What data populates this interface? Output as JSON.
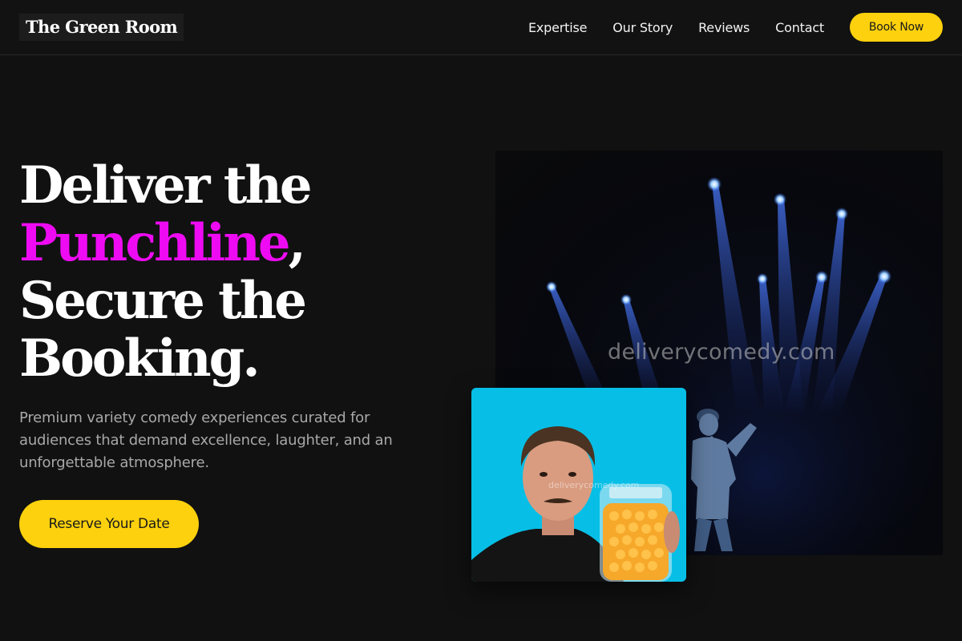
{
  "brand": {
    "name": "The Green Room"
  },
  "nav": {
    "links": [
      "Expertise",
      "Our Story",
      "Reviews",
      "Contact"
    ],
    "cta_label": "Book Now"
  },
  "hero": {
    "title_line1": "Deliver the",
    "title_accent": "Punchline",
    "title_comma": ",",
    "title_line3": "Secure the",
    "title_line4": "Booking.",
    "subtitle": "Premium variety comedy experiences curated for audiences that demand excellence, laughter, and an unforgettable atmosphere.",
    "cta_label": "Reserve Your Date"
  },
  "images": {
    "stage_watermark": "deliverycomedy.com",
    "photo_watermark": "deliverycomedy.com"
  },
  "colors": {
    "accent_yellow": "#fdd10d",
    "accent_magenta": "#ee0bf3",
    "background": "#111111",
    "photo_backdrop": "#07bfe6"
  }
}
